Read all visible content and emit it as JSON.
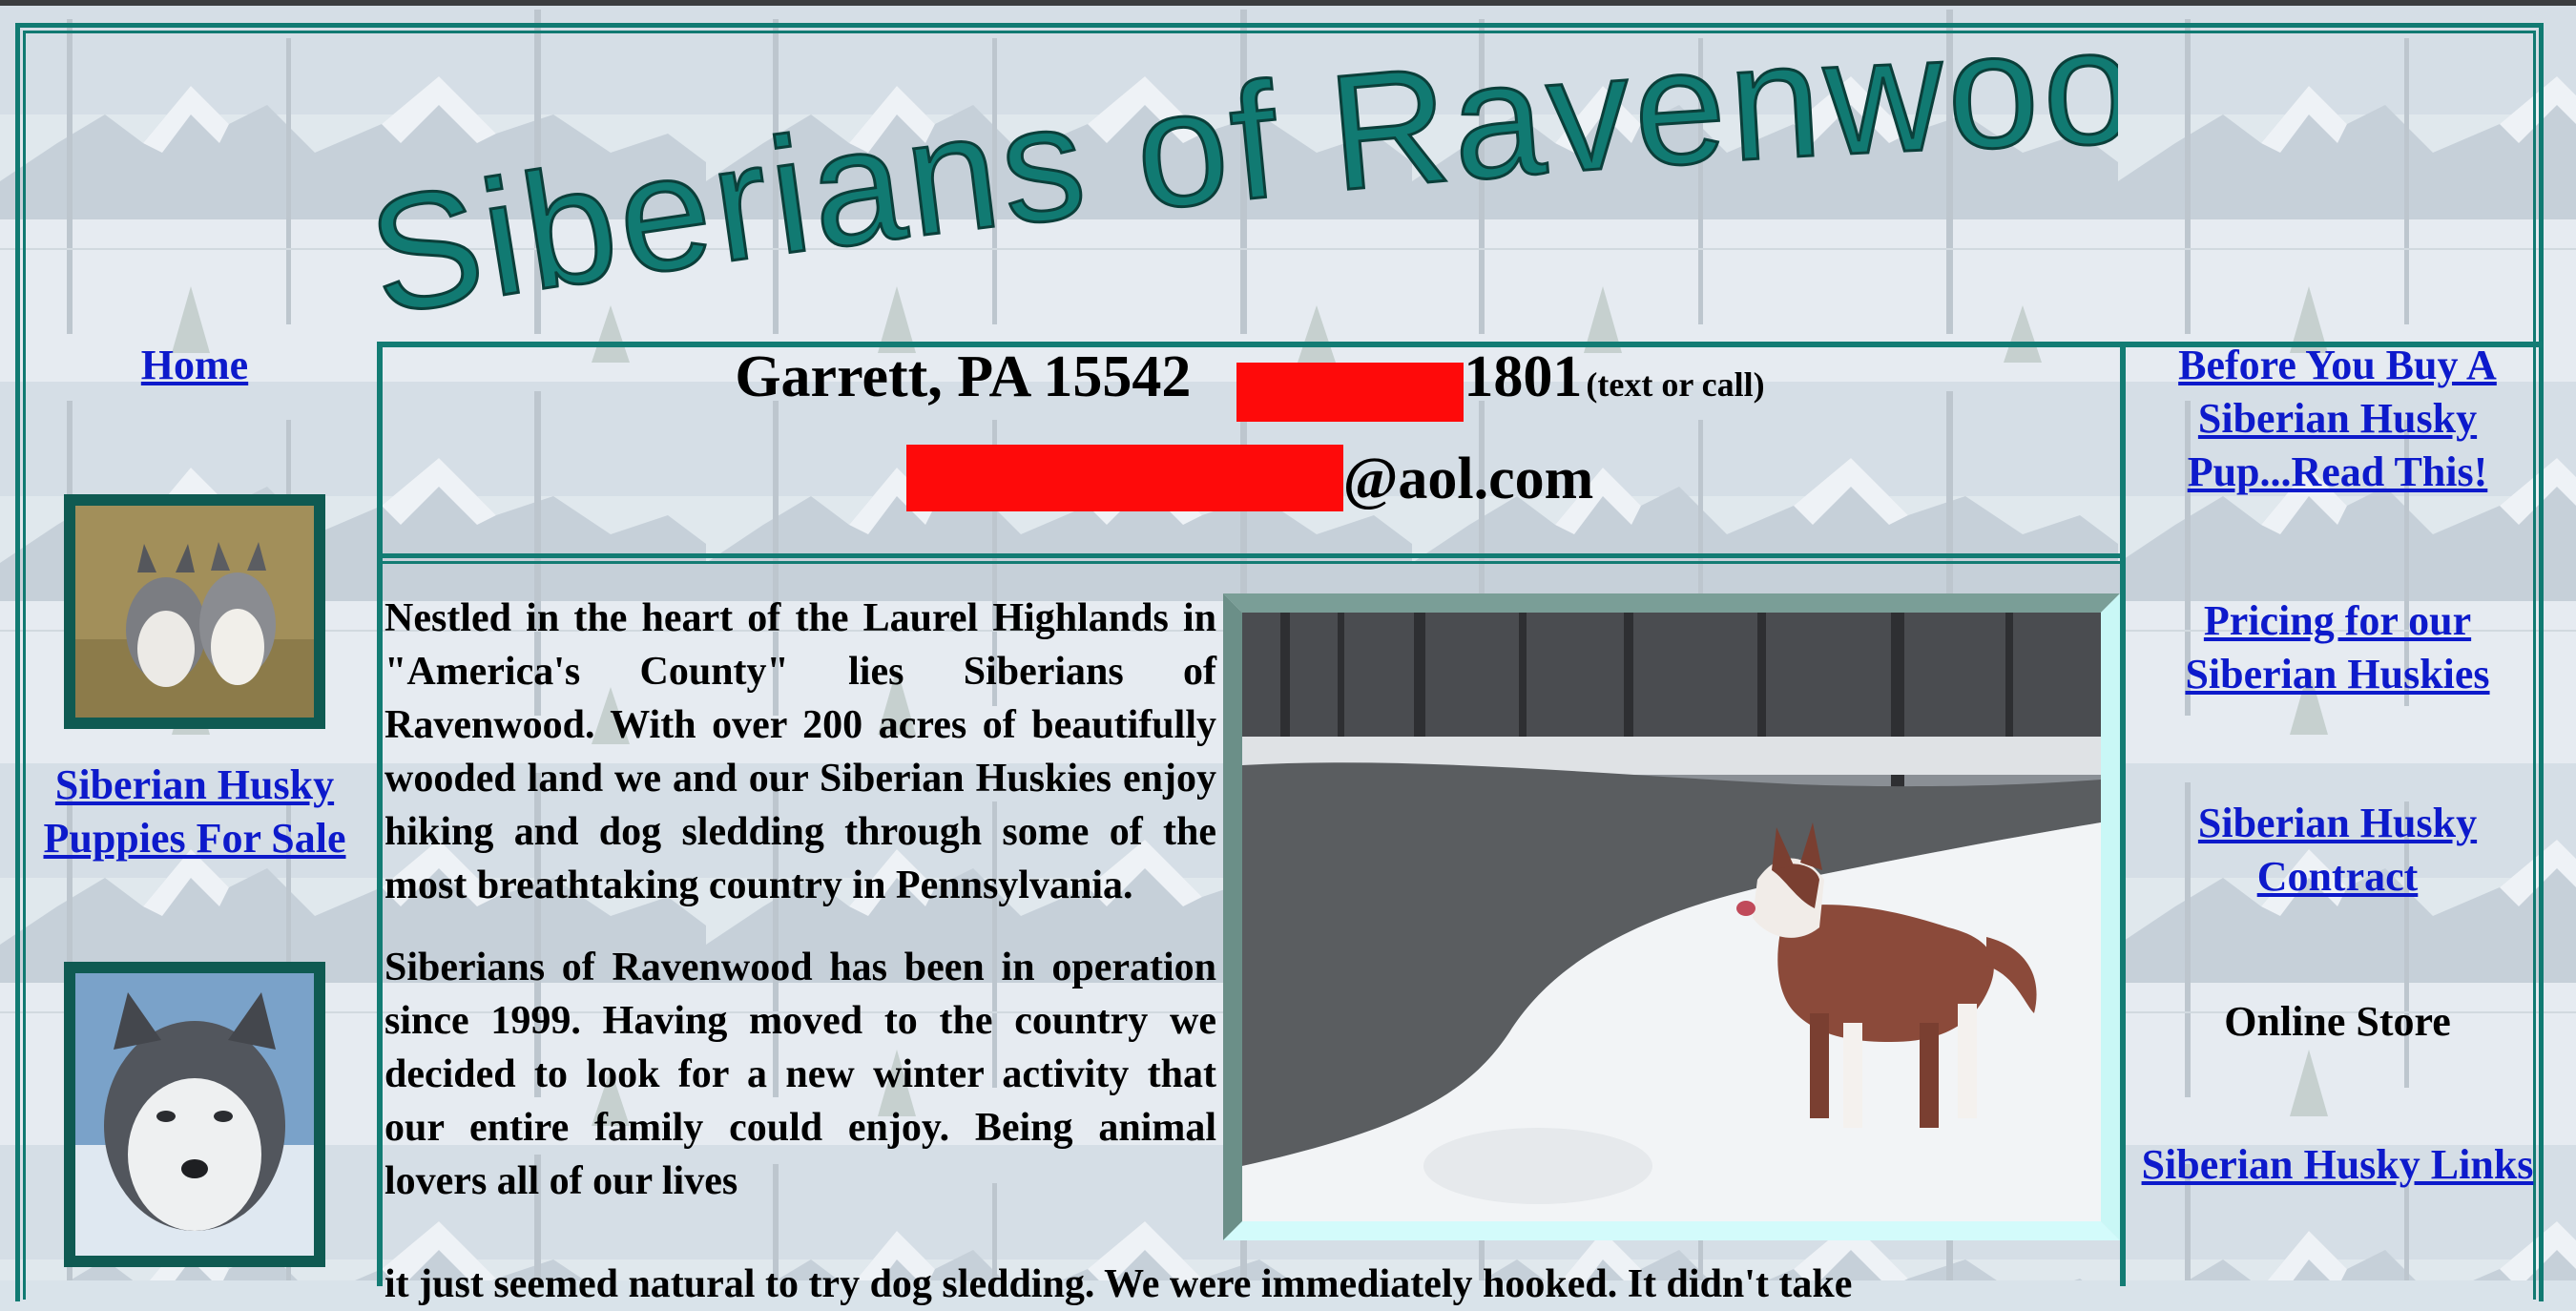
{
  "site": {
    "title": "Siberians of Ravenwood",
    "colors": {
      "teal": "#117a72",
      "link": "#0d1acb",
      "redaction": "#fe0a0a"
    }
  },
  "contact": {
    "location": "Garrett, PA 15542",
    "phone_suffix": "1801",
    "phone_note": "(text or call)",
    "email_domain": "@aol.com"
  },
  "left_nav": {
    "home": "Home",
    "puppies_for_sale": "Siberian Husky Puppies For Sale",
    "images": [
      "two-husky-puppies-photo",
      "husky-face-photo"
    ]
  },
  "right_nav": {
    "before_you_buy": "Before You Buy A Siberian Husky Pup...Read This!",
    "pricing": "Pricing for our Siberian Huskies",
    "contract": "Siberian Husky Contract",
    "online_store": "Online Store",
    "links": "Siberian Husky Links"
  },
  "main": {
    "paragraph1": "Nestled in the heart of the Laurel Highlands in \"America's County\" lies Siberians of Ravenwood. With over 200 acres of beautifully wooded land we and our Siberian Huskies enjoy hiking and dog sledding through some of the most breathtaking country in Pennsylvania.",
    "paragraph2": "Siberians of Ravenwood has been in operation since 1999. Having moved to the country we decided to look for a new winter activity that our entire family could enjoy. Being animal lovers all of our lives",
    "paragraph2_cont": "it just seemed natural to try dog sledding. We were immediately hooked. It didn't take",
    "photo": "husky-in-snow-by-creek-photo"
  }
}
